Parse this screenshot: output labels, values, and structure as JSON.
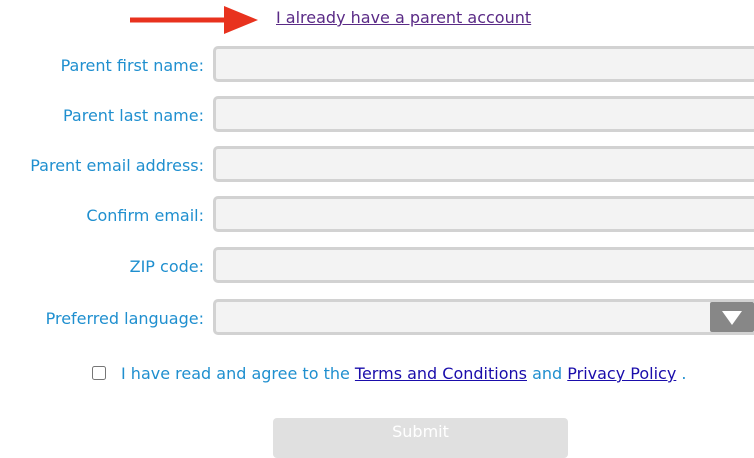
{
  "top_link": {
    "label": "I already have a parent account"
  },
  "form": {
    "fields": [
      {
        "label": "Parent first name:",
        "value": "",
        "placeholder": ""
      },
      {
        "label": "Parent last name:",
        "value": "",
        "placeholder": ""
      },
      {
        "label": "Parent email address:",
        "value": "",
        "placeholder": ""
      },
      {
        "label": "Confirm email:",
        "value": "",
        "placeholder": ""
      },
      {
        "label": "ZIP code:",
        "value": "",
        "placeholder": ""
      }
    ],
    "language": {
      "label": "Preferred language:",
      "selected": ""
    }
  },
  "agreement": {
    "checked": false,
    "prefix": "I have read and agree to the ",
    "terms_label": "Terms and Conditions",
    "middle": " and ",
    "privacy_label": "Privacy Policy",
    "suffix": " ."
  },
  "submit": {
    "label": "Submit"
  },
  "colors": {
    "label_blue": "#1f8fcf",
    "link_purple": "#5a2a86",
    "link_blue": "#1a0dab",
    "arrow_red": "#e8321e",
    "field_bg": "#f3f3f3",
    "field_border": "#d2d2d2",
    "submit_bg": "#e0e0e0"
  },
  "icons": {
    "pointer": "red-arrow-icon",
    "select": "dropdown-caret-icon"
  }
}
